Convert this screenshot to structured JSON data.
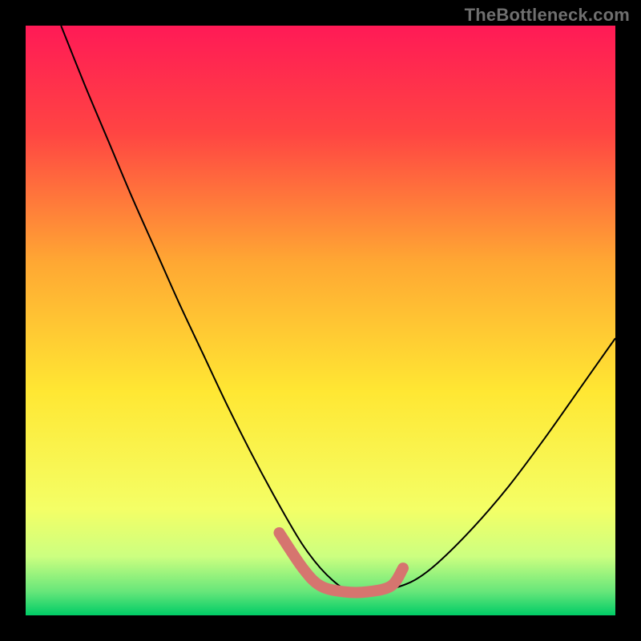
{
  "watermark": "TheBottleneck.com",
  "chart_data": {
    "type": "line",
    "title": "",
    "xlabel": "",
    "ylabel": "",
    "xlim": [
      0,
      100
    ],
    "ylim": [
      0,
      100
    ],
    "grid": false,
    "legend": false,
    "background_gradient": {
      "stops": [
        {
          "pos": 0.0,
          "color": "#ff1a56"
        },
        {
          "pos": 0.18,
          "color": "#ff4443"
        },
        {
          "pos": 0.4,
          "color": "#ffa733"
        },
        {
          "pos": 0.62,
          "color": "#ffe733"
        },
        {
          "pos": 0.82,
          "color": "#f4ff66"
        },
        {
          "pos": 0.9,
          "color": "#ccff80"
        },
        {
          "pos": 0.96,
          "color": "#66e67a"
        },
        {
          "pos": 1.0,
          "color": "#00cc66"
        }
      ]
    },
    "series": [
      {
        "name": "bottleneck-curve",
        "stroke": "#000000",
        "stroke_width": 2,
        "x": [
          6,
          10,
          14,
          18,
          22,
          26,
          30,
          34,
          38,
          42,
          46,
          48,
          50,
          52,
          54,
          56,
          58,
          62,
          66,
          70,
          76,
          82,
          88,
          94,
          100
        ],
        "y": [
          100,
          90,
          80.5,
          71,
          62,
          53,
          44.5,
          36,
          28,
          20.5,
          13.5,
          10.5,
          8,
          6,
          4.5,
          4,
          4,
          4.5,
          6,
          9,
          15,
          22,
          30,
          38.5,
          47
        ]
      },
      {
        "name": "optimum-highlight",
        "stroke": "#d6756f",
        "stroke_width": 14,
        "linecap": "round",
        "x": [
          43,
          47,
          50,
          54,
          58,
          62,
          64
        ],
        "y": [
          14,
          8,
          5,
          4,
          4,
          5,
          8
        ]
      }
    ]
  }
}
